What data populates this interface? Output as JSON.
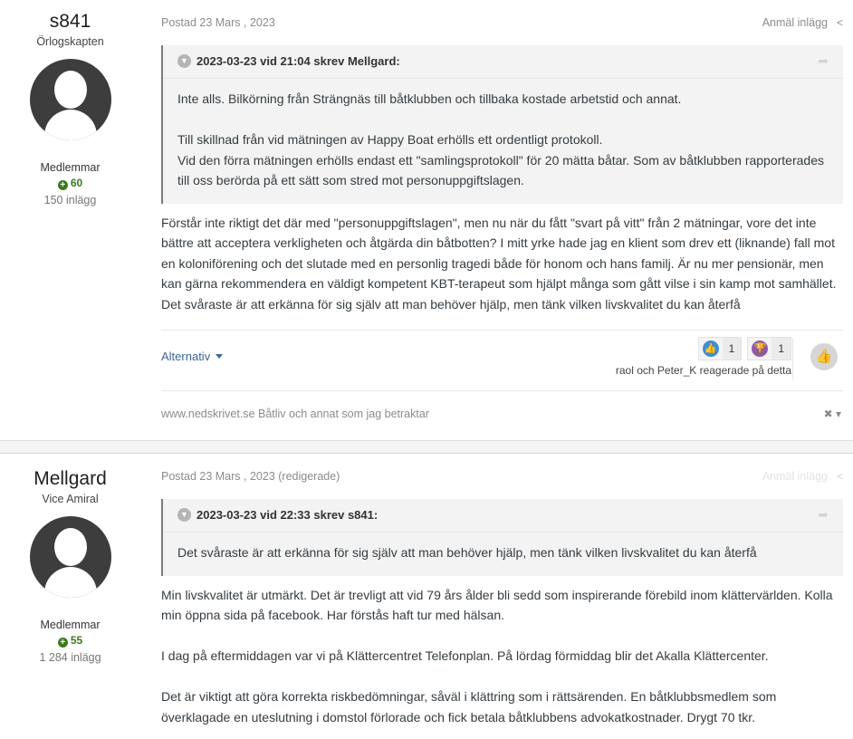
{
  "posts": [
    {
      "author": {
        "name": "s841",
        "rank": "Örlogskapten",
        "group": "Medlemmar",
        "reputation": "60",
        "post_count": "150 inlägg"
      },
      "date": "Postad 23 Mars , 2023",
      "report_label": "Anmäl inlägg",
      "quote": {
        "header": "2023-03-23 vid 21:04 skrev Mellgard:",
        "lines": [
          "Inte alls. Bilkörning från Strängnäs till båtklubben och tillbaka kostade arbetstid och annat.",
          "",
          "Till skillnad från vid mätningen av Happy Boat erhölls ett ordentligt protokoll.",
          "Vid den förra mätningen erhölls endast ett \"samlingsprotokoll\" för 20 mätta båtar. Som av båtklubben rapporterades",
          "till oss berörda på ett sätt som stred mot personuppgiftslagen."
        ]
      },
      "body": [
        "Förstår inte riktigt det där med \"personuppgiftslagen\", men nu när du fått \"svart på vitt\" från 2 mätningar, vore det inte",
        "bättre att acceptera verkligheten och åtgärda din båtbotten? I mitt yrke hade jag en klient som drev ett (liknande) fall mot",
        "en koloniförening och det slutade med en personlig tragedi både för honom och hans familj. Är nu mer pensionär, men",
        "kan gärna rekommendera en väldigt kompetent KBT-terapeut som hjälpt många som gått vilse i sin kamp mot samhället.",
        "Det svåraste är att erkänna för sig själv att man behöver hjälp, men tänk vilken livskvalitet du kan återfå"
      ],
      "options_label": "Alternativ",
      "reactions": [
        {
          "icon": "like-icon",
          "color": "#3b8fd6",
          "count": "1"
        },
        {
          "icon": "trophy-icon",
          "color": "#8e5aa8",
          "count": "1"
        }
      ],
      "reacted_by": "raol och Peter_K reagerade på detta",
      "signature": "www.nedskrivet.se Båtliv och annat som jag betraktar"
    },
    {
      "author": {
        "name": "Mellgard",
        "rank": "Vice Amiral",
        "group": "Medlemmar",
        "reputation": "55",
        "post_count": "1 284 inlägg"
      },
      "date": "Postad 23 Mars , 2023 (redigerade)",
      "report_label": "Anmäl inlägg",
      "quote": {
        "header": "2023-03-23 vid 22:33 skrev s841:",
        "lines": [
          "Det svåraste är att erkänna för sig själv att man behöver hjälp, men tänk vilken livskvalitet du kan återfå"
        ]
      },
      "body": [
        "Min livskvalitet är utmärkt. Det är trevligt att vid 79 års ålder bli sedd som inspirerande förebild inom klättervärlden. Kolla",
        "min öppna sida på facebook. Har förstås haft tur med hälsan.",
        "",
        "I dag på eftermiddagen var vi på Klättercentret Telefonplan. På lördag förmiddag blir det Akalla Klättercenter.",
        "",
        "Det är viktigt att göra korrekta riskbedömningar, såväl  i klättring som i rättsärenden. En båtklubbsmedlem som",
        "överklagade en uteslutning i domstol förlorade och fick betala båtklubbens advokatkostnader. Drygt 70 tkr."
      ]
    }
  ]
}
